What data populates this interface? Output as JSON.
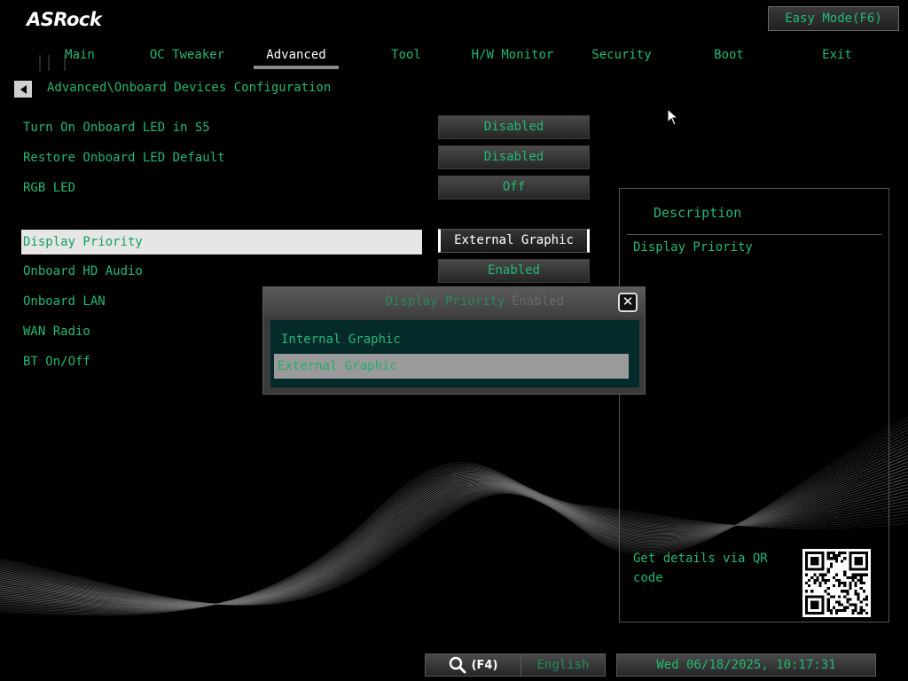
{
  "brand": "ASRock",
  "easy_mode_label": "Easy Mode(F6)",
  "tabs": [
    {
      "label": "Main",
      "active": false
    },
    {
      "label": "OC Tweaker",
      "active": false
    },
    {
      "label": "Advanced",
      "active": true
    },
    {
      "label": "Tool",
      "active": false
    },
    {
      "label": "H/W Monitor",
      "active": false
    },
    {
      "label": "Security",
      "active": false
    },
    {
      "label": "Boot",
      "active": false
    },
    {
      "label": "Exit",
      "active": false
    }
  ],
  "breadcrumb": "Advanced\\Onboard Devices Configuration",
  "settings": [
    {
      "label": "Turn On Onboard LED in S5",
      "value": "Disabled"
    },
    {
      "label": "Restore Onboard LED Default",
      "value": "Disabled"
    },
    {
      "label": "RGB LED",
      "value": "Off"
    },
    {
      "label": "Display Priority",
      "value": "External Graphic",
      "highlighted": true
    },
    {
      "label": "Onboard HD Audio",
      "value": "Enabled"
    },
    {
      "label": "Onboard LAN",
      "value": "Enabled"
    },
    {
      "label": "WAN Radio",
      "value": ""
    },
    {
      "label": "BT On/Off",
      "value": ""
    }
  ],
  "description": {
    "title": "Description",
    "text": "Display Priority",
    "qr_label": "Get details via QR code"
  },
  "popup": {
    "title": "Display Priority",
    "options": [
      {
        "label": "Internal Graphic",
        "selected": false
      },
      {
        "label": "External Graphic",
        "selected": true
      }
    ]
  },
  "footer": {
    "search_shortcut": "(F4)",
    "language": "English",
    "datetime": "Wed 06/18/2025, 10:17:31"
  },
  "colors": {
    "text_green": "#22b873",
    "highlight_row": "#e6e6e6",
    "popup_list_bg": "#052a2a"
  }
}
